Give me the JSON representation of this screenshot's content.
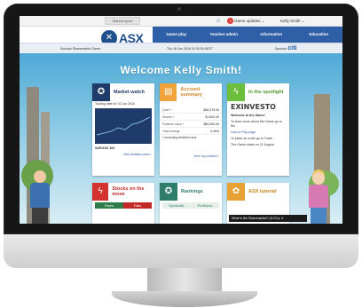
{
  "topbar": {
    "back_label": "Market sport",
    "home_icon": "home-icon",
    "updates_count": "3",
    "updates_label": "Game updates ⌄",
    "user_label": "Kelly Smith ⌄"
  },
  "header": {
    "logo_mark": "✕",
    "logo_text": "ASX",
    "nav": [
      "Game play",
      "Teacher admin",
      "Information",
      "Education"
    ],
    "sub_left": "Schools Sharemarket Game",
    "sub_mid": "Thu 16 Jun 2016 11:00:00 AEST",
    "sub_right_label": "Sponsor",
    "sub_right_brand": "citi"
  },
  "welcome": "Welcome Kelly Smith!",
  "cards": {
    "market_watch": {
      "title": "Market watch",
      "icon": "medal-icon",
      "subtitle": "Trading date for 16 Jun 2016",
      "index_label": "S&P/ASX 200",
      "link": "View detailed panel ›"
    },
    "account_summary": {
      "title": "Account summary",
      "icon": "clipboard-icon",
      "rows": [
        {
          "k": "Cash *",
          "v": "$46,375.00"
        },
        {
          "k": "Shares *",
          "v": "$1,800.00"
        },
        {
          "k": "Portfolio value *",
          "v": "$50,000.00"
        },
        {
          "k": "Total change",
          "v": "0.00%"
        }
      ],
      "footnote": "* excluding deleted trans",
      "link": "View my portfolio ›"
    },
    "spotlight": {
      "title": "In the spotlight",
      "icon": "lightning-icon",
      "brand": "EXINVESTO",
      "heading": "Welcome to the Game!",
      "line1": "To learn more about the Game go to the",
      "line2": "How to Play page.",
      "line3": "To place an order go to Trade.",
      "line4": "The Game starts on 21 August."
    },
    "stocks_move": {
      "title": "Stocks on the move",
      "icon": "lightning-icon",
      "tab_rise": "Rises",
      "tab_fall": "Falls"
    },
    "rankings": {
      "title": "Rankings",
      "icon": "medal-icon",
      "col1": "Syndicate",
      "col2": "Portfolios"
    },
    "tutorial": {
      "title": "ASX tutorial",
      "icon": "palette-icon"
    }
  },
  "tooltip": "What is the Sharemarket? (0:27) ▸ ✕",
  "colors": {
    "nav_blue": "#2f5fa6",
    "market_navy": "#1f3b69",
    "account_orange": "#f0a33b",
    "spotlight_green": "#6bbf3c",
    "stocks_red": "#d2332f",
    "rankings_teal": "#2f7c6b",
    "tutorial_orange": "#e8a234"
  }
}
